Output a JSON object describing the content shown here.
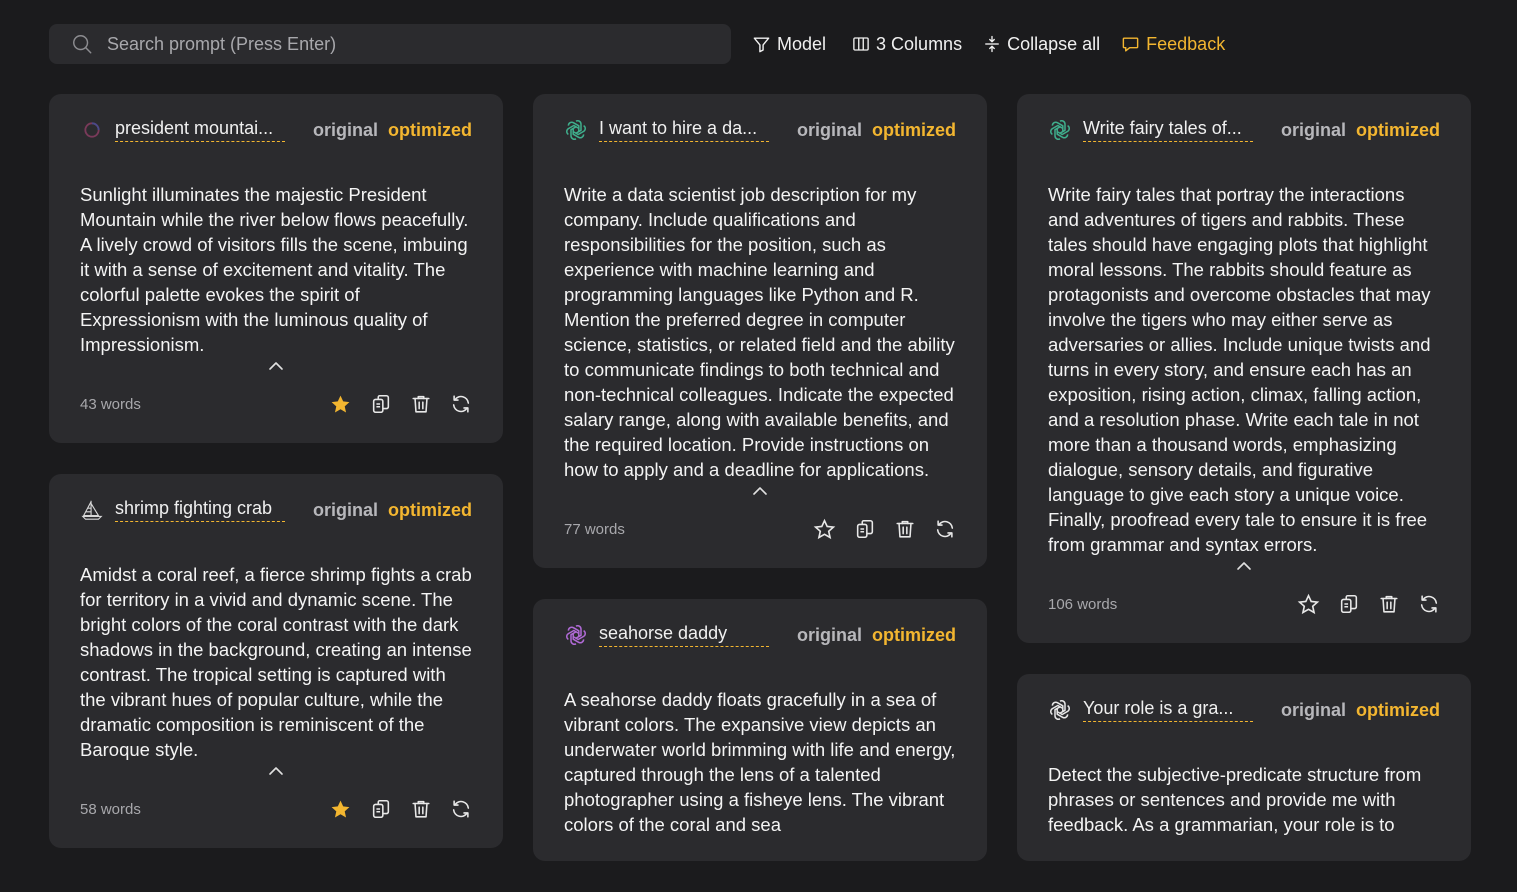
{
  "search": {
    "placeholder": "Search prompt (Press Enter)"
  },
  "toolbar": {
    "model_label": "Model",
    "columns_label": "3 Columns",
    "collapse_label": "Collapse all",
    "feedback_label": "Feedback"
  },
  "version_labels": {
    "original": "original",
    "optimized": "optimized"
  },
  "colors": {
    "accent": "#f3b630",
    "card": "#2b2b2e",
    "background": "#1b1b1d"
  },
  "cards": [
    {
      "icon": "loading-ring-icon",
      "title": "president mountai...",
      "body": "Sunlight illuminates the majestic President Mountain while the river below flows peacefully. A lively crowd of visitors fills the scene, imbuing it with a sense of excitement and vitality. The colorful palette evokes the spirit of Expressionism with the luminous quality of Impressionism.",
      "words": "43 words",
      "starred": true
    },
    {
      "icon": "sailboat-icon",
      "title": "shrimp fighting crab",
      "body": "Amidst a coral reef, a fierce shrimp fights a crab for territory in a vivid and dynamic scene. The bright colors of the coral contrast with the dark shadows in the background, creating an intense contrast. The tropical setting is captured with the vibrant hues of popular culture, while the dramatic composition is reminiscent of the Baroque style.",
      "words": "58 words",
      "starred": true
    },
    {
      "icon": "openai-green-icon",
      "title": "I want to hire a da...",
      "body": "Write a data scientist job description for my company. Include qualifications and responsibilities for the position, such as experience with machine learning and programming languages like Python and R. Mention the preferred degree in computer science, statistics, or related field and the ability to communicate findings to both technical and non-technical colleagues. Indicate the expected salary range, along with available benefits, and the required location. Provide instructions on how to apply and a deadline for applications.",
      "words": "77 words",
      "starred": false
    },
    {
      "icon": "openai-purple-icon",
      "title": "seahorse daddy",
      "body": "A seahorse daddy floats gracefully in a sea of vibrant colors. The expansive view depicts an underwater world brimming with life and energy, captured through the lens of a talented photographer using a fisheye lens. The vibrant colors of the coral and sea",
      "words": "",
      "starred": false
    },
    {
      "icon": "openai-green-icon",
      "title": "Write fairy tales of...",
      "body": "Write fairy tales that portray the interactions and adventures of tigers and rabbits. These tales should have engaging plots that highlight moral lessons. The rabbits should feature as protagonists and overcome obstacles that may involve the tigers who may either serve as adversaries or allies. Include unique twists and turns in every story, and ensure each has an exposition, rising action, climax, falling action, and a resolution phase. Write each tale in not more than a thousand words, emphasizing dialogue, sensory details, and figurative language to give each story a unique voice. Finally, proofread every tale to ensure it is free from grammar and syntax errors.",
      "words": "106 words",
      "starred": false
    },
    {
      "icon": "openai-white-icon",
      "title": "Your role is a gra...",
      "body": "Detect the subjective-predicate structure from phrases or sentences and provide me with feedback. As a grammarian, your role is to",
      "words": "",
      "starred": false
    }
  ]
}
